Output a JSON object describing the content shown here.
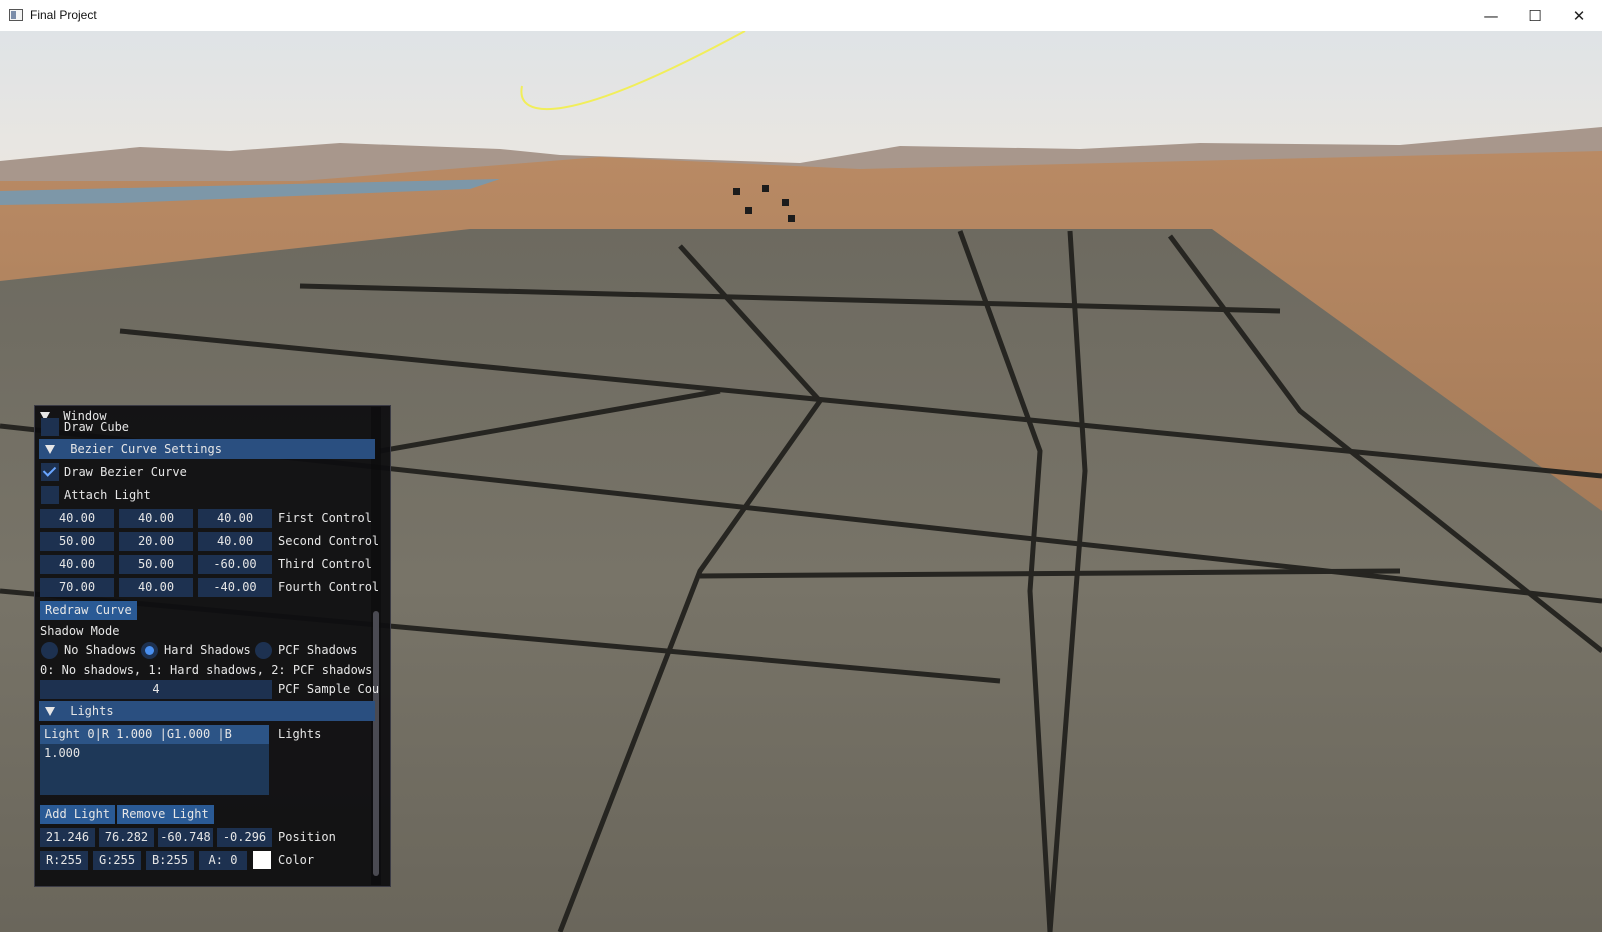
{
  "window": {
    "title": "Final Project",
    "controls": {
      "minimize": "—",
      "maximize": "☐",
      "close": "✕"
    }
  },
  "panel": {
    "title": "Window",
    "draw_cube": {
      "label": "Draw Cube",
      "checked": false
    },
    "bezier": {
      "header": "Bezier Curve Settings",
      "draw_bezier": {
        "label": "Draw Bezier Curve",
        "checked": true
      },
      "attach_light": {
        "label": "Attach Light",
        "checked": false
      },
      "controls": [
        {
          "label": "First Control",
          "values": [
            "40.00",
            "40.00",
            "40.00"
          ]
        },
        {
          "label": "Second Control",
          "values": [
            "50.00",
            "20.00",
            "40.00"
          ]
        },
        {
          "label": "Third Control",
          "values": [
            "40.00",
            "50.00",
            "-60.00"
          ]
        },
        {
          "label": "Fourth Control",
          "values": [
            "70.00",
            "40.00",
            "-40.00"
          ]
        }
      ],
      "redraw_button": "Redraw Curve"
    },
    "shadow": {
      "label": "Shadow Mode",
      "options": [
        "No Shadows",
        "Hard Shadows",
        "PCF Shadows"
      ],
      "selected": "Hard Shadows",
      "help": "0: No shadows, 1: Hard shadows, 2: PCF shadows",
      "pcf_value": "4",
      "pcf_label": "PCF Sample Cou"
    },
    "lights": {
      "header": "Lights",
      "list_label": "Lights",
      "items": [
        "Light 0|R 1.000 |G1.000 |B 1.000"
      ],
      "add_button": "Add Light",
      "remove_button": "Remove Light",
      "position": {
        "label": "Position",
        "values": [
          "21.246",
          "76.282",
          "-60.748",
          "-0.296"
        ]
      },
      "color": {
        "label": "Color",
        "values": [
          "R:255",
          "G:255",
          "B:255",
          "A:  0"
        ],
        "swatch": "#ffffff"
      }
    }
  },
  "colors": {
    "header": "#2a4f80",
    "frame": "#1d3150",
    "button": "#2a5a95",
    "curve": "#f1ee5a"
  }
}
